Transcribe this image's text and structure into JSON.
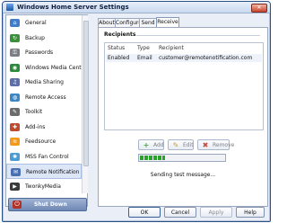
{
  "window": {
    "title": "Windows Home Server Settings",
    "close_glyph": "✕"
  },
  "sidebar": {
    "items": [
      {
        "label": "General",
        "icon": "house-icon",
        "color": "#3f7cc9",
        "glyph": "⌂"
      },
      {
        "label": "Backup",
        "icon": "backup-icon",
        "color": "#3a8f3a",
        "glyph": "↻"
      },
      {
        "label": "Passwords",
        "icon": "key-icon",
        "color": "#7a7f86",
        "glyph": "⚿"
      },
      {
        "label": "Windows Media Center",
        "icon": "media-center-icon",
        "color": "#2d8a3d",
        "glyph": "◉"
      },
      {
        "label": "Media Sharing",
        "icon": "media-sharing-icon",
        "color": "#5c6fa8",
        "glyph": "♫"
      },
      {
        "label": "Remote Access",
        "icon": "globe-icon",
        "color": "#3b86c6",
        "glyph": "◍"
      },
      {
        "label": "Toolkit",
        "icon": "toolkit-icon",
        "color": "#6b6b6b",
        "glyph": "✎"
      },
      {
        "label": "Add-ins",
        "icon": "add-ins-icon",
        "color": "#c24a2c",
        "glyph": "✚"
      },
      {
        "label": "Feedsource",
        "icon": "feed-icon",
        "color": "#f39a1b",
        "glyph": "≋"
      },
      {
        "label": "MSS Fan Control",
        "icon": "fan-icon",
        "color": "#4b9bd5",
        "glyph": "✺"
      },
      {
        "label": "Remote Notification",
        "icon": "notification-icon",
        "color": "#4a6fb0",
        "glyph": "✉",
        "selected": true
      },
      {
        "label": "TwonkyMedia",
        "icon": "twonky-icon",
        "color": "#3a3a3a",
        "glyph": "▶"
      }
    ],
    "shutdown_label": "Shut Down",
    "shutdown_glyph": "⏻"
  },
  "tabs": [
    {
      "label": "About"
    },
    {
      "label": "Configure"
    },
    {
      "label": "Send"
    },
    {
      "label": "Receive",
      "selected": true
    }
  ],
  "recipients": {
    "title": "Recipients",
    "columns": [
      "Status",
      "Type",
      "Recipient"
    ],
    "rows": [
      {
        "status": "Enabled",
        "type": "Email",
        "recipient": "customer@remotenotification.com"
      }
    ]
  },
  "actions": {
    "add": "Add",
    "edit": "Edit",
    "remove": "Remove",
    "add_glyph": "+",
    "edit_glyph": "✎",
    "remove_glyph": "✖"
  },
  "progress": {
    "fraction": 0.3
  },
  "status_text": "Sending test message...",
  "footer": {
    "ok": "OK",
    "cancel": "Cancel",
    "apply": "Apply",
    "help": "Help"
  }
}
